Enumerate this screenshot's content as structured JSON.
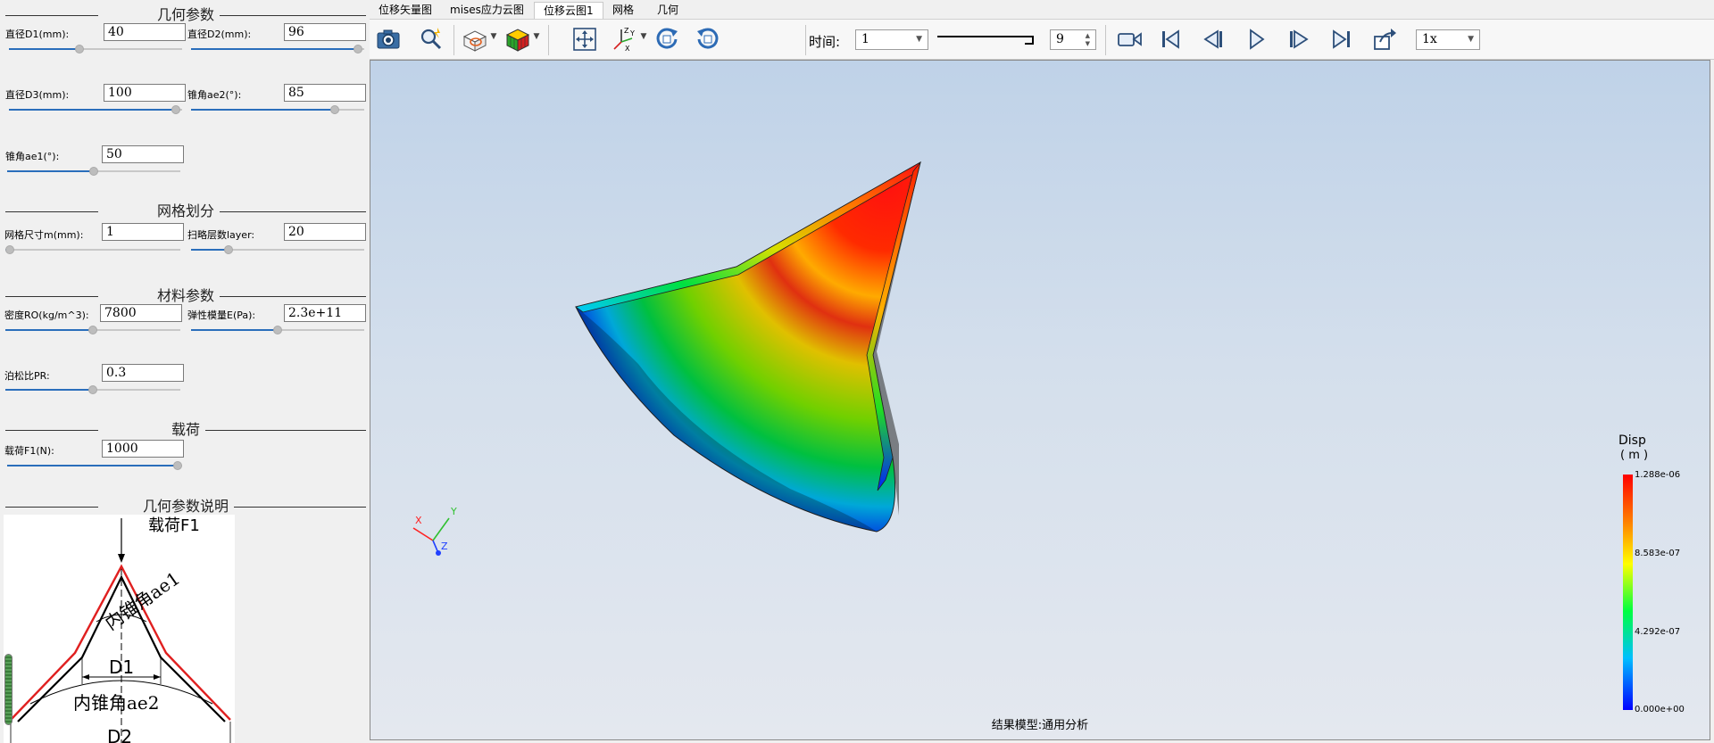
{
  "left_panel": {
    "sections": {
      "geometry": "几何参数",
      "mesh": "网格划分",
      "material": "材料参数",
      "load": "载荷",
      "geometry_desc": "几何参数说明"
    },
    "params": {
      "d1_label": "直径D1(mm):",
      "d1_value": "40",
      "d1_level": 0.4,
      "d2_label": "直径D2(mm):",
      "d2_value": "96",
      "d2_level": 0.99,
      "d3_label": "直径D3(mm):",
      "d3_value": "100",
      "d3_level": 0.99,
      "ae2_label": "锥角ae2(°):",
      "ae2_value": "85",
      "ae2_level": 0.85,
      "ae1_label": "锥角ae1(°):",
      "ae1_value": "50",
      "ae1_level": 0.5,
      "mesh_label": "网格尺寸m(mm):",
      "mesh_value": "1",
      "mesh_level": 0.0,
      "layer_label": "扫略层数layer:",
      "layer_value": "20",
      "layer_level": 0.2,
      "rho_label": "密度RO(kg/m^3):",
      "rho_value": "7800",
      "rho_level": 0.5,
      "e_label": "弹性模量E(Pa):",
      "e_value": "2.3e+11",
      "e_level": 0.5,
      "pr_label": "泊松比PR:",
      "pr_value": "0.3",
      "pr_level": 0.5,
      "f1_label": "载荷F1(N):",
      "f1_value": "1000",
      "f1_level": 1.0
    },
    "diagram": {
      "load_label": "载荷F1",
      "inner_cone_ae1": "内锥角ae1",
      "d1": "D1",
      "inner_cone_ae2": "内锥角ae2",
      "d2": "D2"
    }
  },
  "tabs": [
    {
      "label": "位移矢量图",
      "active": false
    },
    {
      "label": "mises应力云图",
      "active": false
    },
    {
      "label": "位移云图1",
      "active": true
    },
    {
      "label": "网格",
      "active": false
    },
    {
      "label": "几何",
      "active": false
    }
  ],
  "toolbar": {
    "icons": [
      "camera-icon",
      "zoom-magic-icon",
      "section-view-icon",
      "display-cube-icon",
      "fit-view-icon",
      "axes-icon",
      "rotate-cw-icon",
      "rotate-ccw-icon"
    ],
    "time_label": "时间:",
    "time_value": "1",
    "frame_level": 1.0,
    "frame_value": "9",
    "speed_value": "1x",
    "player_icons": [
      "record-icon",
      "first-frame-icon",
      "prev-frame-icon",
      "play-icon",
      "next-frame-icon",
      "last-frame-icon",
      "export-icon"
    ]
  },
  "viewport": {
    "status": "结果模型:通用分析",
    "triad": {
      "x": "X",
      "y": "Y",
      "z": "Z"
    },
    "colors": {
      "x_axis": "#ff2020",
      "y_axis": "#30c030",
      "z_axis": "#2040ff"
    }
  },
  "legend": {
    "title": "Disp",
    "unit": "( m )",
    "max": "1.288e-06",
    "mid_high": "8.583e-07",
    "mid_low": "4.292e-07",
    "min": "0.000e+00"
  }
}
